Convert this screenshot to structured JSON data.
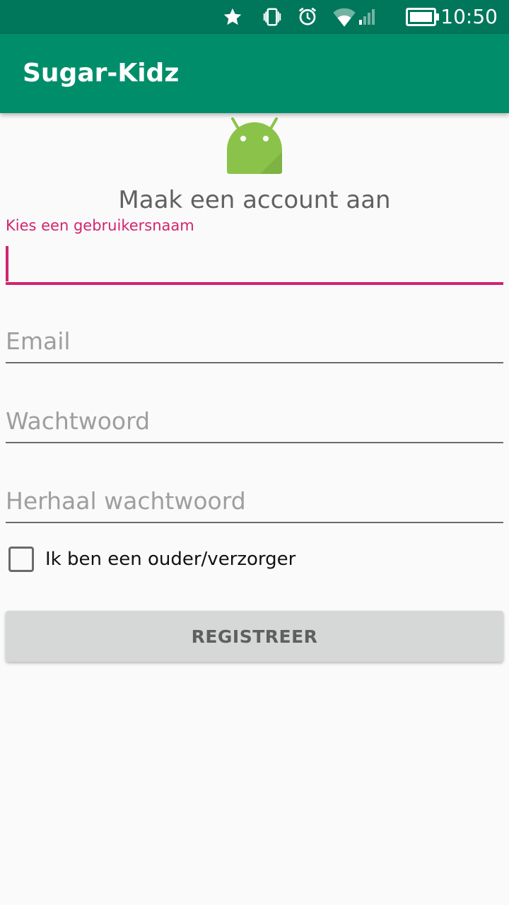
{
  "status_bar": {
    "time": "10:50",
    "icons": [
      "star-icon",
      "vibrate-icon",
      "alarm-icon",
      "wifi-icon",
      "signal-icon",
      "battery-icon"
    ],
    "background": "#00765a"
  },
  "app_bar": {
    "title": "Sugar-Kidz",
    "background": "#008e6a"
  },
  "form": {
    "heading": "Maak een account aan",
    "username": {
      "label": "Kies een gebruikersnaam",
      "value": ""
    },
    "email": {
      "placeholder": "Email",
      "value": ""
    },
    "password": {
      "placeholder": "Wachtwoord",
      "value": ""
    },
    "password_repeat": {
      "placeholder": "Herhaal wachtwoord",
      "value": ""
    },
    "parent_checkbox": {
      "label": "Ik ben een ouder/verzorger",
      "checked": false
    },
    "submit_label": "REGISTREER"
  },
  "colors": {
    "accent": "#d2246f",
    "android_green": "#8bc34a"
  }
}
